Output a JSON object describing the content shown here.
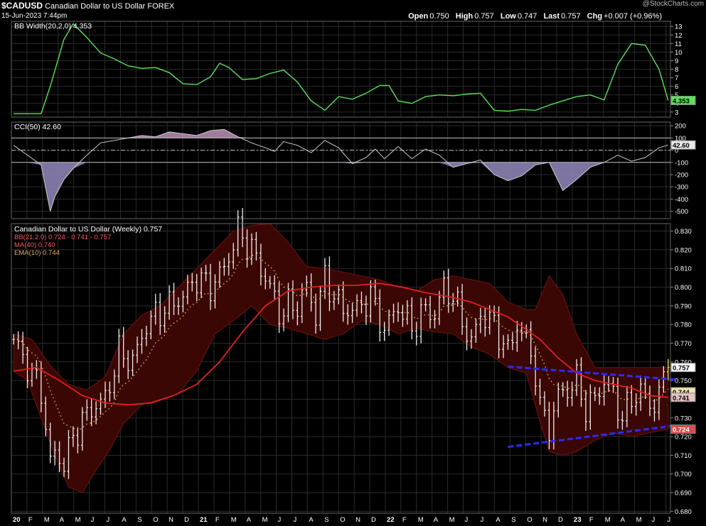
{
  "header": {
    "symbol": "$CADUSD",
    "name": "Canadian Dollar to US Dollar",
    "exchange": "FOREX",
    "date": "15-Jun-2023 7:44pm",
    "watermark": "@StockCharts.com",
    "open_label": "Open",
    "open": "0.750",
    "high_label": "High",
    "high": "0.757",
    "low_label": "Low",
    "low": "0.747",
    "last_label": "Last",
    "last": "0.757",
    "chg_label": "Chg",
    "chg": "+0.007 (+0.96%)"
  },
  "colors": {
    "background": "#000000",
    "grid": "#2b2b2b",
    "bbwidth": "#5be05b",
    "cci_line": "#cccccc",
    "cci_fill": "#8c7fb3",
    "cci_fill_top": "#b08aae",
    "bands_fill": "#3a0705",
    "bands_line": "#6e1411",
    "price_bars": "#f2e9e9",
    "ma40": "#e02020",
    "ema10": "#e2b04a",
    "trendlines": "#2b2bff",
    "last_highlight": "#f1e65a"
  },
  "chart_data": [
    {
      "type": "line",
      "panel": "bb_width",
      "legend": "BB Width(20,2,0) 4.353",
      "value_label": "4.353",
      "y_ticks": [
        3,
        4,
        5,
        6,
        7,
        8,
        9,
        10,
        11,
        12,
        13
      ],
      "ylim": [
        2.4,
        13.6
      ],
      "series": [
        {
          "name": "BB Width(20,2,0)",
          "x": [
            0,
            6,
            8,
            11,
            13,
            16,
            19,
            22,
            25,
            28,
            31,
            34,
            37,
            40,
            43,
            45,
            47,
            50,
            53,
            56,
            59,
            62,
            65,
            68,
            71,
            74,
            77,
            80,
            82,
            84,
            87,
            90,
            93,
            96,
            99,
            102,
            105,
            108,
            111,
            114,
            117,
            120,
            123,
            126,
            129,
            132,
            135,
            138,
            141,
            143
          ],
          "values": [
            2.8,
            2.8,
            6.0,
            11.5,
            13.3,
            11.7,
            9.9,
            9.2,
            8.4,
            8.1,
            8.2,
            7.6,
            6.3,
            6.2,
            7.1,
            8.7,
            8.2,
            6.8,
            6.9,
            7.5,
            7.9,
            6.5,
            4.3,
            3.2,
            4.8,
            4.5,
            5.2,
            6.1,
            6.1,
            4.3,
            4.0,
            4.8,
            5.0,
            4.9,
            5.1,
            5.2,
            3.2,
            3.1,
            3.3,
            3.2,
            3.8,
            4.3,
            4.8,
            5.0,
            4.4,
            8.6,
            11.0,
            10.8,
            8.0,
            4.35
          ]
        }
      ]
    },
    {
      "type": "line",
      "panel": "cci",
      "legend": "CCI(50) 42.60",
      "value_label": "42.60",
      "y_ticks": [
        200,
        100,
        0,
        -100,
        -200,
        -300,
        -400,
        -500
      ],
      "ylim": [
        -560,
        230
      ],
      "reference_lines": [
        100,
        0,
        -100
      ],
      "series": [
        {
          "name": "CCI(50)",
          "x": [
            0,
            3,
            6,
            8,
            9,
            11,
            13,
            16,
            19,
            22,
            25,
            28,
            31,
            34,
            37,
            40,
            43,
            46,
            49,
            52,
            55,
            57,
            59,
            62,
            65,
            68,
            71,
            74,
            77,
            79,
            81,
            84,
            87,
            90,
            93,
            96,
            99,
            102,
            105,
            108,
            111,
            114,
            117,
            120,
            123,
            126,
            129,
            132,
            135,
            138,
            141,
            143
          ],
          "values": [
            40,
            -40,
            -120,
            -500,
            -380,
            -240,
            -150,
            -40,
            60,
            80,
            100,
            120,
            110,
            150,
            135,
            120,
            160,
            170,
            110,
            60,
            20,
            -10,
            70,
            40,
            -20,
            80,
            20,
            -110,
            -60,
            10,
            -70,
            30,
            -70,
            10,
            -40,
            -140,
            -110,
            -80,
            -200,
            -250,
            -210,
            -120,
            -100,
            -330,
            -240,
            -140,
            -100,
            -40,
            -90,
            -60,
            20,
            43
          ]
        }
      ]
    },
    {
      "type": "candlestick",
      "panel": "price",
      "legend": "Canadian Dollar to US Dollar (Weekly) 0.757",
      "legend_bb": "BB(21,2.0) 0.724 - 0.741 - 0.757",
      "legend_ma": "MA(40) 0.740",
      "legend_ema": "EMA(10) 0.744",
      "value_labels": [
        "0.757",
        "0.744",
        "0.741",
        "0.724"
      ],
      "y_ticks": [
        0.68,
        0.69,
        0.7,
        0.71,
        0.72,
        0.73,
        0.74,
        0.75,
        0.76,
        0.77,
        0.78,
        0.79,
        0.8,
        0.81,
        0.82,
        0.83
      ],
      "ylim": [
        0.679,
        0.834
      ],
      "x_labels": [
        "20",
        "F",
        "M",
        "A",
        "M",
        "J",
        "J",
        "A",
        "S",
        "O",
        "N",
        "D",
        "21",
        "F",
        "M",
        "A",
        "M",
        "J",
        "J",
        "A",
        "S",
        "O",
        "N",
        "D",
        "22",
        "F",
        "M",
        "A",
        "M",
        "J",
        "J",
        "A",
        "S",
        "O",
        "N",
        "D",
        "23",
        "F",
        "M",
        "A",
        "M",
        "J",
        "J"
      ],
      "close_anchors": {
        "x": [
          0,
          4,
          6,
          8,
          9,
          11,
          13,
          15,
          17,
          20,
          23,
          26,
          29,
          31,
          34,
          37,
          40,
          43,
          46,
          49,
          52,
          54,
          56,
          58,
          60,
          62,
          64,
          66,
          68,
          70,
          72,
          75,
          78,
          81,
          84,
          87,
          90,
          92,
          94,
          96,
          98,
          100,
          102,
          104,
          106,
          108,
          110,
          112,
          114,
          115,
          117,
          119,
          121,
          123,
          125,
          127,
          129,
          131,
          133,
          135,
          137,
          139,
          141,
          143
        ],
        "values": [
          0.772,
          0.753,
          0.745,
          0.705,
          0.712,
          0.705,
          0.72,
          0.728,
          0.735,
          0.74,
          0.765,
          0.76,
          0.78,
          0.785,
          0.79,
          0.795,
          0.805,
          0.8,
          0.81,
          0.83,
          0.82,
          0.81,
          0.8,
          0.786,
          0.79,
          0.79,
          0.8,
          0.785,
          0.805,
          0.795,
          0.788,
          0.788,
          0.795,
          0.777,
          0.79,
          0.778,
          0.788,
          0.785,
          0.8,
          0.795,
          0.782,
          0.77,
          0.785,
          0.783,
          0.775,
          0.765,
          0.78,
          0.772,
          0.755,
          0.735,
          0.725,
          0.742,
          0.745,
          0.75,
          0.735,
          0.74,
          0.75,
          0.742,
          0.73,
          0.74,
          0.745,
          0.736,
          0.742,
          0.757
        ]
      },
      "ma40": {
        "x": [
          0,
          5,
          10,
          15,
          20,
          25,
          30,
          35,
          40,
          45,
          50,
          55,
          60,
          65,
          70,
          75,
          80,
          85,
          90,
          95,
          100,
          105,
          108,
          111,
          115,
          119,
          123,
          127,
          131,
          135,
          139,
          143
        ],
        "values": [
          0.755,
          0.757,
          0.75,
          0.742,
          0.738,
          0.737,
          0.738,
          0.742,
          0.748,
          0.76,
          0.776,
          0.79,
          0.798,
          0.8,
          0.801,
          0.801,
          0.802,
          0.8,
          0.797,
          0.795,
          0.792,
          0.787,
          0.784,
          0.779,
          0.772,
          0.762,
          0.754,
          0.75,
          0.748,
          0.746,
          0.742,
          0.741
        ]
      },
      "bollinger_upper": {
        "x": [
          0,
          4,
          8,
          12,
          16,
          20,
          24,
          28,
          32,
          36,
          40,
          44,
          48,
          52,
          56,
          60,
          64,
          68,
          72,
          76,
          80,
          84,
          88,
          92,
          96,
          100,
          104,
          108,
          112,
          114,
          117,
          120,
          123,
          127,
          131,
          135,
          139,
          143
        ],
        "values": [
          0.775,
          0.772,
          0.758,
          0.748,
          0.745,
          0.752,
          0.775,
          0.785,
          0.79,
          0.8,
          0.81,
          0.82,
          0.83,
          0.833,
          0.834,
          0.824,
          0.811,
          0.81,
          0.808,
          0.806,
          0.804,
          0.8,
          0.798,
          0.804,
          0.806,
          0.804,
          0.802,
          0.792,
          0.788,
          0.788,
          0.806,
          0.796,
          0.775,
          0.757,
          0.757,
          0.757,
          0.757,
          0.757
        ]
      },
      "bollinger_lower": {
        "x": [
          0,
          3,
          6,
          9,
          12,
          15,
          18,
          21,
          24,
          28,
          32,
          36,
          40,
          44,
          48,
          52,
          56,
          60,
          64,
          68,
          72,
          76,
          80,
          84,
          88,
          92,
          96,
          100,
          104,
          108,
          112,
          115,
          117,
          120,
          123,
          127,
          131,
          135,
          139,
          143
        ],
        "values": [
          0.755,
          0.75,
          0.73,
          0.71,
          0.693,
          0.69,
          0.702,
          0.713,
          0.727,
          0.737,
          0.74,
          0.743,
          0.755,
          0.775,
          0.782,
          0.79,
          0.78,
          0.778,
          0.775,
          0.772,
          0.775,
          0.782,
          0.78,
          0.775,
          0.778,
          0.776,
          0.775,
          0.768,
          0.764,
          0.757,
          0.754,
          0.728,
          0.712,
          0.71,
          0.712,
          0.718,
          0.722,
          0.72,
          0.722,
          0.724
        ]
      },
      "trendlines": [
        {
          "x": [
            108,
            143
          ],
          "values": [
            0.7575,
            0.7505
          ]
        },
        {
          "x": [
            108,
            143
          ],
          "values": [
            0.7145,
            0.726
          ]
        }
      ]
    }
  ]
}
